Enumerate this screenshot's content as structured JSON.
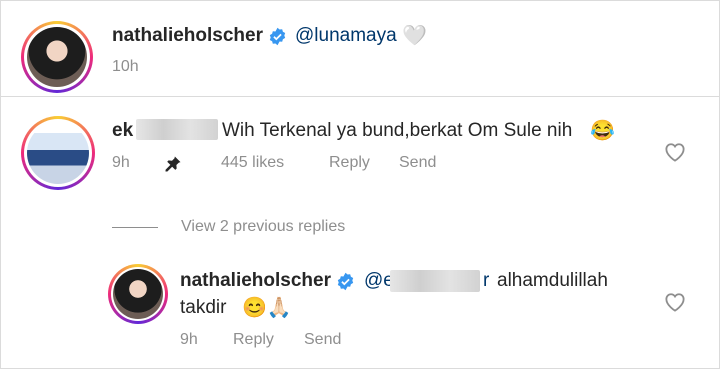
{
  "post": {
    "username": "nathalieholscher",
    "caption_mention": "@lunamaya",
    "caption_emoji": "🤍",
    "time": "10h"
  },
  "comment": {
    "username_visible": "ek",
    "text": "Wih Terkenal ya bund,berkat Om Sule nih",
    "emoji": "😂",
    "time": "9h",
    "likes": "445 likes",
    "reply_label": "Reply",
    "send_label": "Send"
  },
  "view_replies_label": "View 2 previous replies",
  "reply": {
    "username": "nathalieholscher",
    "mention_prefix": "@e",
    "mention_suffix": "r",
    "text_line1": "alhamdulillah",
    "text_line2": "takdir",
    "emojis": "😊🙏🏻",
    "time": "9h",
    "reply_label": "Reply",
    "send_label": "Send"
  },
  "colors": {
    "verified": "#3897f0",
    "mention": "#00376b",
    "meta": "#8e8e8e"
  }
}
